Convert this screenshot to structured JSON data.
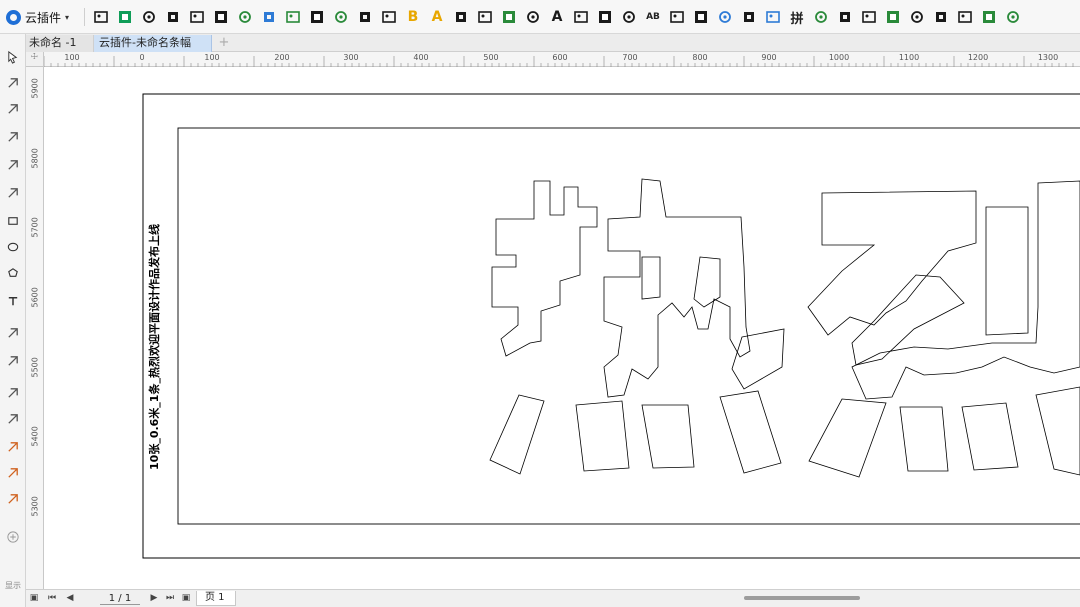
{
  "plugin_menu": {
    "label": "云插件",
    "caret": "▾"
  },
  "toolbar": {
    "icons": [
      "picture-icon",
      "k-icon",
      "node-icon",
      "frame-icon",
      "image-frame-icon",
      "text-t-icon",
      "text-size-icon",
      "text-a-icon",
      "square-icon",
      "paste-icon",
      "grid-icon",
      "rotate-icon",
      "r-icon",
      "bold-b-icon",
      "letter-a-icon",
      "pdf-icon",
      "curve-icon",
      "ra-icon",
      "qr-icon",
      "font-a-icon",
      "photo-icon",
      "link-icon",
      "quote-6-icon",
      "ab-icon",
      "quote-icon",
      "comment-icon",
      "crop-icon",
      "record-icon",
      "pattern-icon",
      "pin-icon",
      "c-icon",
      "list-icon",
      "clipboard-icon",
      "text-align-icon",
      "x-box-icon",
      "shield-icon",
      "translate-icon",
      "magic-icon",
      "layers-icon"
    ],
    "glyph_labels": {
      "bold_b": "B",
      "letter_a": "A",
      "ab": "AB",
      "pin": "拼"
    }
  },
  "tabs": {
    "items": [
      {
        "label": "未命名 -1",
        "active": false
      },
      {
        "label": "云插件-未命名条幅",
        "active": true
      }
    ],
    "add_label": "+"
  },
  "tools": [
    "pick-tool-icon",
    "shape-tool-icon",
    "crop-tool-icon",
    "zoom-tool-icon",
    "freehand-tool-icon",
    "artistic-media-icon",
    "rectangle-tool-icon",
    "ellipse-tool-icon",
    "polygon-tool-icon",
    "text-tool-icon",
    "parallel-dimension-icon",
    "connector-icon",
    "drop-shadow-icon",
    "transparency-icon",
    "eyedropper-icon",
    "fill-tool-icon",
    "smart-fill-icon",
    "add-tool-icon"
  ],
  "ruler": {
    "horizontal_labels": [
      "100",
      "0",
      "100",
      "200",
      "300",
      "400",
      "500",
      "600",
      "700",
      "800",
      "900",
      "1000",
      "1100",
      "1200",
      "1300"
    ],
    "vertical_labels": [
      "5900",
      "5800",
      "5700",
      "5600",
      "5500",
      "5400",
      "5300"
    ],
    "corner": "☩"
  },
  "canvas": {
    "vertical_caption": "10张_0.6米_1条_热烈欢迎平面设计作品发布上线",
    "banner_text": "热烈",
    "colors": {
      "outline": "#000000",
      "page_border": "#000000"
    }
  },
  "bottom": {
    "page_count": "1 / 1",
    "page_tab": "页 1",
    "nav": {
      "first": "⏮",
      "prev": "◀",
      "next": "▶",
      "last": "⏭"
    },
    "side_note": "显示"
  }
}
